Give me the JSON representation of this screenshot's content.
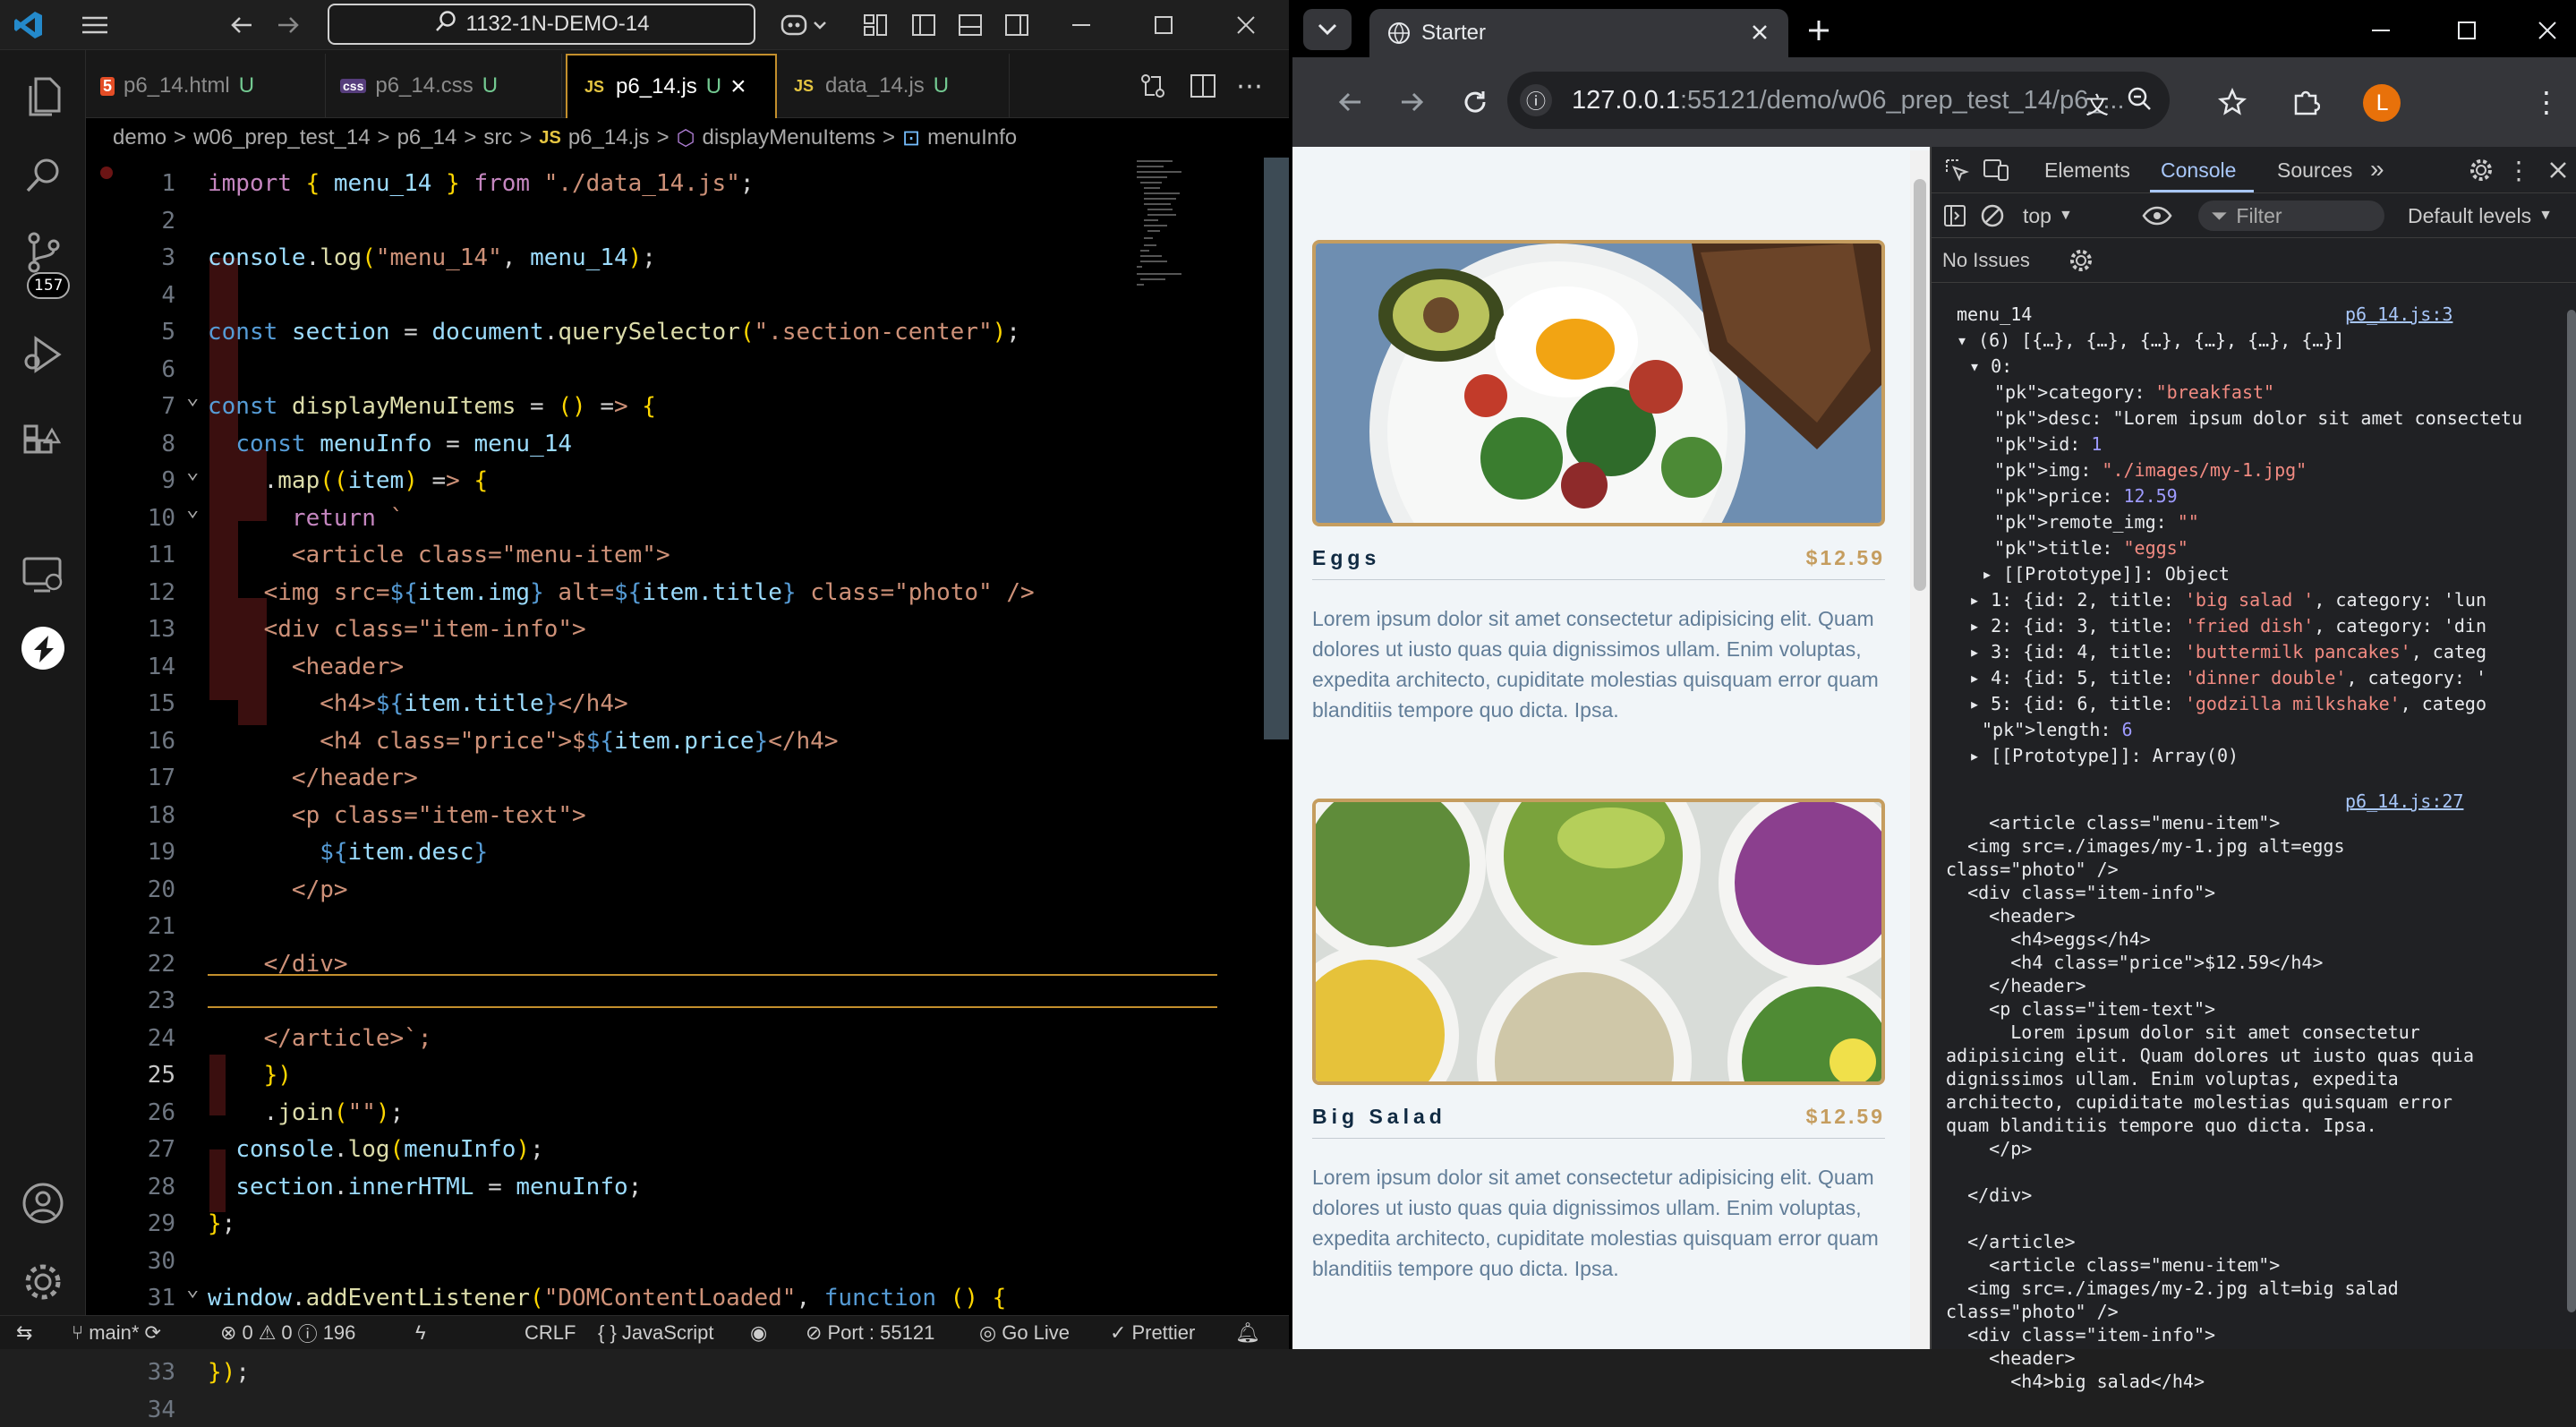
{
  "vscode": {
    "command_center": "1132-1N-DEMO-14",
    "tabs": [
      {
        "icon": "5",
        "name": "p6_14.html",
        "status": "U"
      },
      {
        "icon": "css",
        "name": "p6_14.css",
        "status": "U"
      },
      {
        "icon": "JS",
        "name": "p6_14.js",
        "status": "U",
        "close": "×"
      },
      {
        "icon": "JS",
        "name": "data_14.js",
        "status": "U"
      }
    ],
    "breadcrumb": [
      "demo",
      ">",
      "w06_prep_test_14",
      ">",
      "p6_14",
      ">",
      "src",
      ">",
      "JS",
      "p6_14.js",
      ">",
      "displayMenuItems",
      ">",
      "menuInfo"
    ],
    "scm_badge": "157",
    "lines": [
      {
        "n": "1",
        "t": "import { menu_14 } from \"./data_14.js\";"
      },
      {
        "n": "2",
        "t": ""
      },
      {
        "n": "3",
        "t": "console.log(\"menu_14\", menu_14);"
      },
      {
        "n": "4",
        "t": ""
      },
      {
        "n": "5",
        "t": "const section = document.querySelector(\".section-center\");"
      },
      {
        "n": "6",
        "t": ""
      },
      {
        "n": "7",
        "t": "const displayMenuItems = () => {"
      },
      {
        "n": "8",
        "t": "  const menuInfo = menu_14"
      },
      {
        "n": "9",
        "t": "    .map((item) => {"
      },
      {
        "n": "10",
        "t": "      return `"
      },
      {
        "n": "11",
        "t": "      <article class=\"menu-item\">"
      },
      {
        "n": "12",
        "t": "    <img src=${item.img} alt=${item.title} class=\"photo\" />"
      },
      {
        "n": "13",
        "t": "    <div class=\"item-info\">"
      },
      {
        "n": "14",
        "t": "      <header>"
      },
      {
        "n": "15",
        "t": "        <h4>${item.title}</h4>"
      },
      {
        "n": "16",
        "t": "        <h4 class=\"price\">$${item.price}</h4>"
      },
      {
        "n": "17",
        "t": "      </header>"
      },
      {
        "n": "18",
        "t": "      <p class=\"item-text\">"
      },
      {
        "n": "19",
        "t": "        ${item.desc}"
      },
      {
        "n": "20",
        "t": "      </p>"
      },
      {
        "n": "21",
        "t": ""
      },
      {
        "n": "22",
        "t": "    </div>"
      },
      {
        "n": "23",
        "t": ""
      },
      {
        "n": "24",
        "t": "    </article>`;"
      },
      {
        "n": "25",
        "t": "    })"
      },
      {
        "n": "26",
        "t": "    .join(\"\");"
      },
      {
        "n": "27",
        "t": "  console.log(menuInfo);"
      },
      {
        "n": "28",
        "t": "  section.innerHTML = menuInfo;"
      },
      {
        "n": "29",
        "t": "};"
      },
      {
        "n": "30",
        "t": ""
      },
      {
        "n": "31",
        "t": "window.addEventListener(\"DOMContentLoaded\", function () {"
      },
      {
        "n": "32",
        "t": "  displayMenuItems(menu_14);"
      },
      {
        "n": "33",
        "t": "});"
      },
      {
        "n": "34",
        "t": ""
      }
    ],
    "status": {
      "branch": "main*",
      "errors": "0",
      "warnings": "0",
      "info": "196",
      "eol": "CRLF",
      "language": "JavaScript",
      "port": "Port : 55121",
      "golive": "Go Live",
      "prettier": "Prettier"
    }
  },
  "browser": {
    "tab_title": "Starter",
    "url": "127.0.0.1:55121/demo/w06_prep_test_14/p6_...",
    "url_host": "127.0.0.1",
    "url_rest": ":55121/demo/w06_prep_test_14/p6_...",
    "profile": "L",
    "menu_items": [
      {
        "title": "Eggs",
        "price": "$12.59",
        "desc": "Lorem ipsum dolor sit amet consectetur adipisicing elit. Quam dolores ut iusto quas quia dignissimos ullam. Enim voluptas, expedita architecto, cupiditate molestias quisquam error quam blanditiis tempore quo dicta. Ipsa."
      },
      {
        "title": "Big Salad",
        "price": "$12.59",
        "desc": "Lorem ipsum dolor sit amet consectetur adipisicing elit. Quam dolores ut iusto quas quia dignissimos ullam. Enim voluptas, expedita architecto, cupiditate molestias quisquam error quam blanditiis tempore quo dicta. Ipsa."
      }
    ]
  },
  "devtools": {
    "tabs": [
      "Elements",
      "Console",
      "Sources",
      "»"
    ],
    "context": "top",
    "filter_placeholder": "Filter",
    "levels": "Default levels",
    "issues": "No Issues",
    "console_lines": [
      {
        "t": "menu_14",
        "x": 0,
        "src": "p6_14.js:3"
      },
      {
        "t": "▾ (6) [{…}, {…}, {…}, {…}, {…}, {…}]",
        "x": 0
      },
      {
        "t": "▾ 0:",
        "x": 1
      },
      {
        "t": "category: \"breakfast\"",
        "x": 3
      },
      {
        "t": "desc: \"Lorem ipsum dolor sit amet consectetu",
        "x": 3
      },
      {
        "t": "id: 1",
        "x": 3
      },
      {
        "t": "img: \"./images/my-1.jpg\"",
        "x": 3
      },
      {
        "t": "price: 12.59",
        "x": 3
      },
      {
        "t": "remote_img: \"\"",
        "x": 3
      },
      {
        "t": "title: \"eggs\"",
        "x": 3
      },
      {
        "t": "▸ [[Prototype]]: Object",
        "x": 2
      },
      {
        "t": "▸ 1: {id: 2, title: 'big salad ', category: 'lun",
        "x": 1
      },
      {
        "t": "▸ 2: {id: 3, title: 'fried dish', category: 'din",
        "x": 1
      },
      {
        "t": "▸ 3: {id: 4, title: 'buttermilk pancakes', categ",
        "x": 1
      },
      {
        "t": "▸ 4: {id: 5, title: 'dinner double', category: '",
        "x": 1
      },
      {
        "t": "▸ 5: {id: 6, title: 'godzilla milkshake', catego",
        "x": 1
      },
      {
        "t": "length: 6",
        "x": 2
      },
      {
        "t": "▸ [[Prototype]]: Array(0)",
        "x": 1
      }
    ],
    "html_output_src": "p6_14.js:27",
    "html_output": [
      "    <article class=\"menu-item\">",
      "  <img src=./images/my-1.jpg alt=eggs",
      "class=\"photo\" />",
      "  <div class=\"item-info\">",
      "    <header>",
      "      <h4>eggs</h4>",
      "      <h4 class=\"price\">$12.59</h4>",
      "    </header>",
      "    <p class=\"item-text\">",
      "      Lorem ipsum dolor sit amet consectetur",
      "adipisicing elit. Quam dolores ut iusto quas quia",
      "dignissimos ullam. Enim voluptas, expedita",
      "architecto, cupiditate molestias quisquam error",
      "quam blanditiis tempore quo dicta. Ipsa.",
      "    </p>",
      "",
      "  </div>",
      "",
      "  </article>",
      "    <article class=\"menu-item\">",
      "  <img src=./images/my-2.jpg alt=big salad",
      "class=\"photo\" />",
      "  <div class=\"item-info\">",
      "    <header>",
      "      <h4>big salad</h4>"
    ]
  },
  "colors": {
    "accent": "#c59d5f",
    "vscode_accent": "#c38f2c"
  }
}
